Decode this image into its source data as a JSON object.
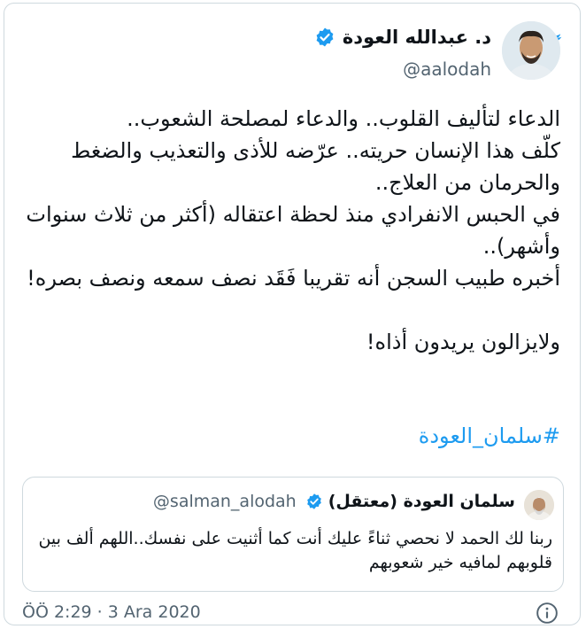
{
  "tweet": {
    "author_name": "د. عبدالله العودة",
    "author_handle": "@aalodah",
    "body": "الدعاء لتأليف القلوب.. والدعاء لمصلحة الشعوب..\nكلّف هذا الإنسان حريته.. عرّضه للأذى والتعذيب والضغط والحرمان من العلاج..\nفي الحبس الانفرادي منذ لحظة اعتقاله (أكثر من ثلاث سنوات وأشهر)..\nأخبره طبيب السجن أنه تقريبا فَقَد نصف سمعه ونصف بصره!\n\nولايزالون يريدون أذاه!",
    "hashtag": "#سلمان_العودة",
    "timestamp": "ÖÖ 2:29 · 3 Ara 2020"
  },
  "quoted_tweet": {
    "author_name": "سلمان العودة (معتقل)",
    "author_handle": "@salman_alodah",
    "body": "ربنا لك الحمد لا نحصي ثناءً عليك أنت كما أثنيت على نفسك..اللهم ألف بين قلوبهم لمافيه خير شعوبهم"
  },
  "icons": {
    "brand": "twitter-bird-icon",
    "verified": "verified-badge-icon",
    "info": "info-icon"
  },
  "colors": {
    "accent": "#1d9bf0",
    "text": "#0f1419",
    "secondary": "#536471",
    "border": "#cfd9de"
  }
}
